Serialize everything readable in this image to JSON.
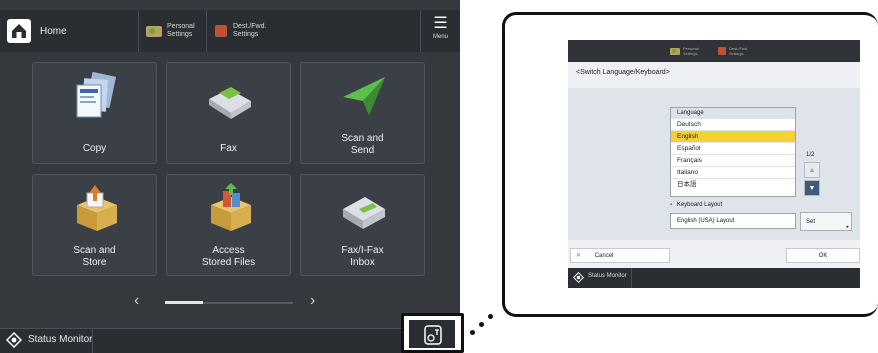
{
  "home": {
    "title": "Home",
    "personal_settings": "Personal\nSettings",
    "dest_fwd_settings": "Dest./Fwd.\nSettings",
    "menu": "Menu",
    "tiles": [
      "Copy",
      "Fax",
      "Scan and\nSend",
      "Scan and\nStore",
      "Access\nStored Files",
      "Fax/I-Fax\nInbox"
    ],
    "pager_prev": "‹",
    "pager_next": "›",
    "status_monitor": "Status Monitor"
  },
  "switch_language": {
    "top_personal": "Personal\nSettings",
    "top_dest": "Dest./Fwd.\nSettings",
    "title": "<Switch Language/Keyboard>",
    "list_header": "Language",
    "languages": [
      "Deutsch",
      "English",
      "Español",
      "Français",
      "Italiano",
      "日本語"
    ],
    "selected_language": "English",
    "page_indicator": "1/2",
    "keyboard_layout_label": "Keyboard Layout",
    "keyboard_layout_value": "English (USA) Layout",
    "set": "Set",
    "cancel": "Cancel",
    "ok": "OK",
    "status_monitor": "Status Monitor"
  },
  "colors": {
    "home_bg": "#35393e",
    "topbar": "#2a2d32",
    "highlight": "#f4d235",
    "accent_blue": "#3f5a78"
  }
}
